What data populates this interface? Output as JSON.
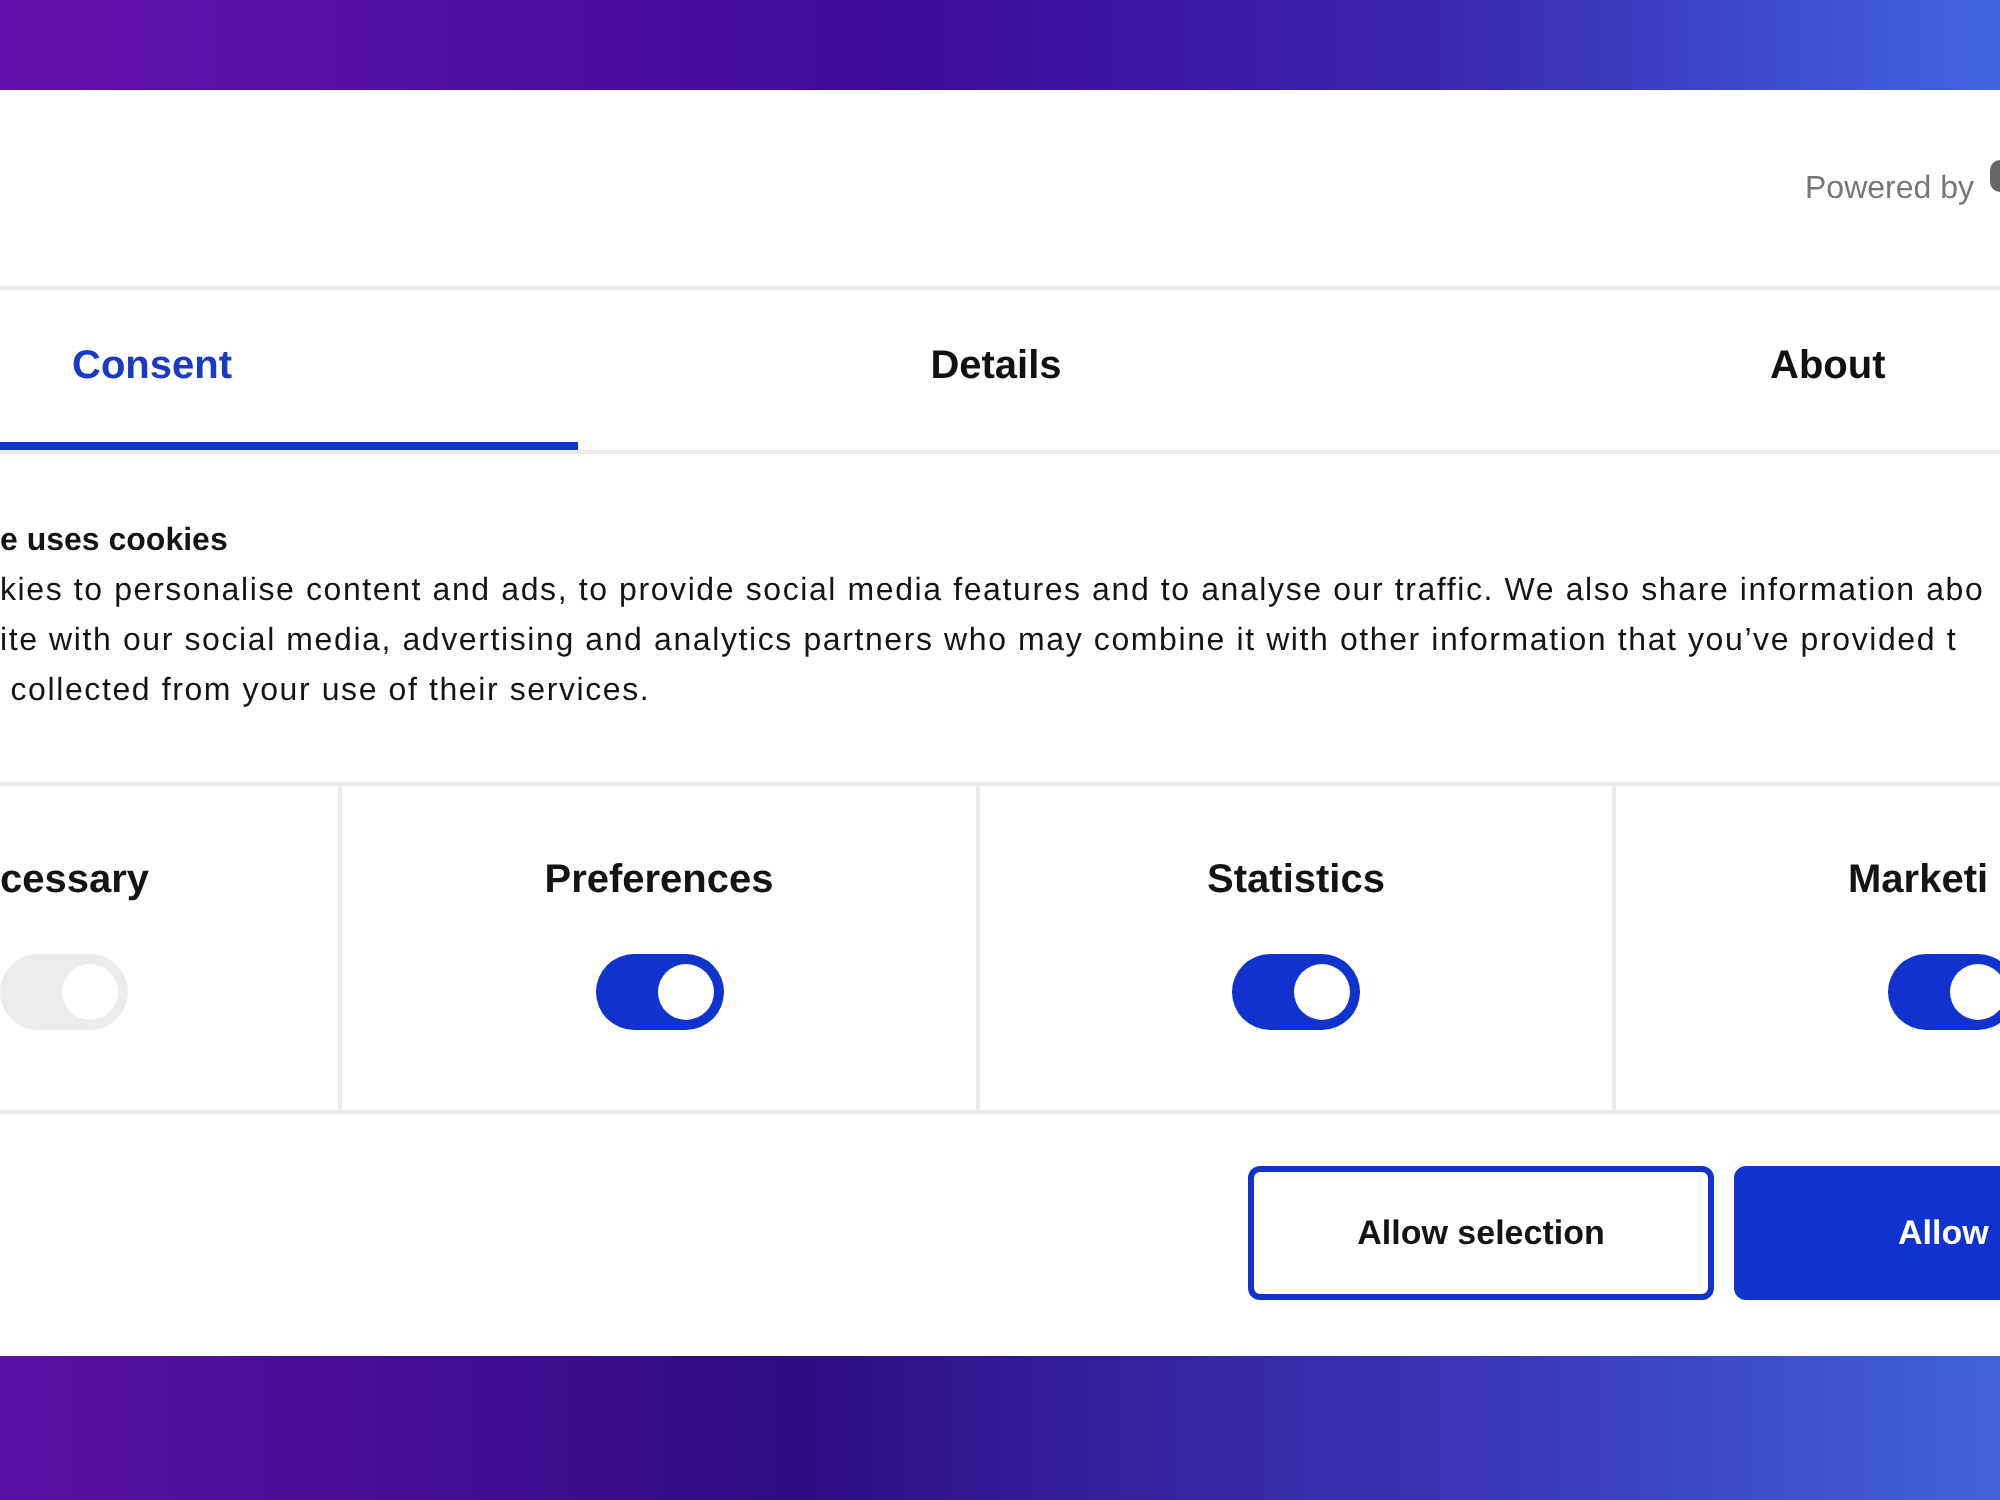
{
  "header": {
    "powered_by": "Powered by"
  },
  "tabs": [
    {
      "label": "Consent",
      "selected": true
    },
    {
      "label": "Details",
      "selected": false
    },
    {
      "label": "About",
      "selected": false
    }
  ],
  "intro": {
    "title": "e uses cookies",
    "lines": [
      "kies to personalise content and ads, to provide social media features and to analyse our traffic. We also share information abo",
      "ite with our social media, advertising and analytics partners who may combine it with other information that you’ve provided t",
      " collected from your use of their services."
    ]
  },
  "categories": [
    {
      "label": "cessary",
      "checked": true,
      "disabled": true
    },
    {
      "label": "Preferences",
      "checked": true,
      "disabled": false
    },
    {
      "label": "Statistics",
      "checked": true,
      "disabled": false
    },
    {
      "label": "Marketi",
      "checked": true,
      "disabled": false
    }
  ],
  "buttons": [
    {
      "label": "Allow selection",
      "kind": "outline"
    },
    {
      "label": "Allow",
      "kind": "filled"
    }
  ]
}
